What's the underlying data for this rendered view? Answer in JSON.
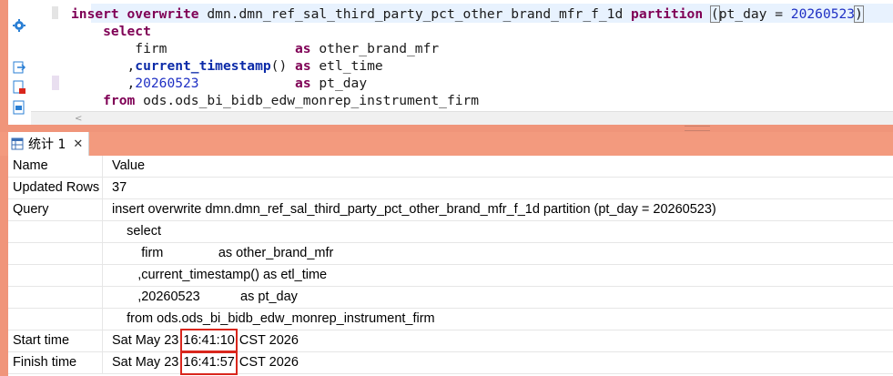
{
  "editor": {
    "code_lines": [
      [
        {
          "t": "insert overwrite ",
          "c": "kw"
        },
        {
          "t": "dmn.dmn_ref_sal_third_party_pct_other_brand_mfr_f_1d ",
          "c": ""
        },
        {
          "t": "partition ",
          "c": "kw"
        },
        {
          "t": "(",
          "c": "paren"
        },
        {
          "t": "pt_day = ",
          "c": ""
        },
        {
          "t": "20260523",
          "c": "num"
        },
        {
          "t": ")",
          "c": "paren"
        }
      ],
      [
        {
          "t": "    select",
          "c": "kw"
        }
      ],
      [
        {
          "t": "        firm                ",
          "c": ""
        },
        {
          "t": "as ",
          "c": "kw"
        },
        {
          "t": "other_brand_mfr",
          "c": ""
        }
      ],
      [
        {
          "t": "       ,",
          "c": ""
        },
        {
          "t": "current_timestamp",
          "c": "fn"
        },
        {
          "t": "() ",
          "c": ""
        },
        {
          "t": "as ",
          "c": "kw"
        },
        {
          "t": "etl_time",
          "c": ""
        }
      ],
      [
        {
          "t": "       ,",
          "c": ""
        },
        {
          "t": "20260523",
          "c": "num"
        },
        {
          "t": "            ",
          "c": ""
        },
        {
          "t": "as ",
          "c": "kw"
        },
        {
          "t": "pt_day",
          "c": ""
        }
      ],
      [
        {
          "t": "    from ",
          "c": "kw"
        },
        {
          "t": "ods.ods_bi_bidb_edw_monrep_instrument_firm",
          "c": ""
        }
      ]
    ]
  },
  "results_tab": {
    "label": "统计 1",
    "close": "✕"
  },
  "table": {
    "rows": [
      {
        "name": "Name",
        "value": "Value"
      },
      {
        "name": "Updated Rows",
        "value": "37"
      },
      {
        "name": "Query",
        "value": "insert overwrite dmn.dmn_ref_sal_third_party_pct_other_brand_mfr_f_1d partition (pt_day = 20260523)"
      },
      {
        "name": "",
        "value": "    select"
      },
      {
        "name": "",
        "value": "        firm               as other_brand_mfr"
      },
      {
        "name": "",
        "value": "       ,current_timestamp() as etl_time"
      },
      {
        "name": "",
        "value": "       ,20260523           as pt_day"
      },
      {
        "name": "",
        "value": "    from ods.ods_bi_bidb_edw_monrep_instrument_firm"
      }
    ],
    "start": {
      "name": "Start time",
      "prefix": "Sat May 23 ",
      "time": "16:41:10",
      "suffix": " CST 2026"
    },
    "finish": {
      "name": "Finish time",
      "prefix": "Sat May 23 ",
      "time": "16:41:57",
      "suffix": " CST 2026"
    }
  },
  "colors": {
    "accent_salmon": "#f0957a",
    "keyword": "#7f0055",
    "highlight_box": "#d9261c"
  }
}
